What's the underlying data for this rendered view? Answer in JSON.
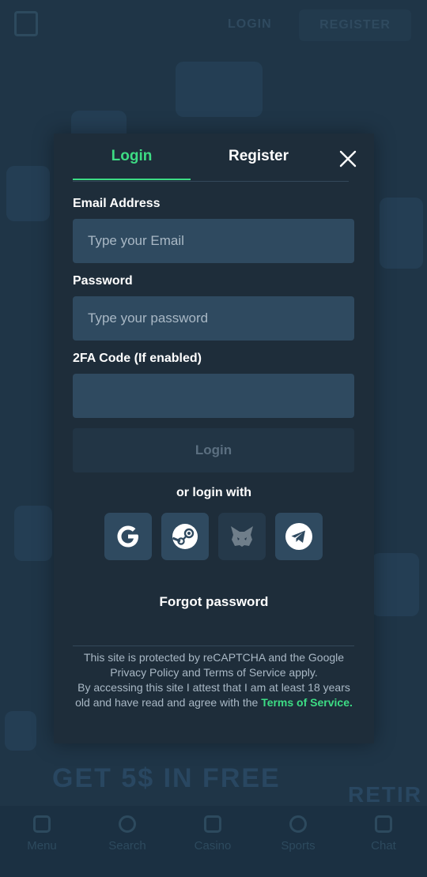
{
  "background": {
    "header_login": "LOGIN",
    "header_register": "REGISTER",
    "promo_text": "GET 5$ IN FREE",
    "side_text": "RETIR",
    "nav": [
      {
        "label": "Menu",
        "icon": "menu-icon"
      },
      {
        "label": "Search",
        "icon": "search-icon"
      },
      {
        "label": "Casino",
        "icon": "casino-icon"
      },
      {
        "label": "Sports",
        "icon": "sports-icon"
      },
      {
        "label": "Chat",
        "icon": "chat-icon"
      }
    ]
  },
  "modal": {
    "tabs": {
      "login": "Login",
      "register": "Register"
    },
    "email": {
      "label": "Email Address",
      "placeholder": "Type your Email",
      "value": ""
    },
    "password": {
      "label": "Password",
      "placeholder": "Type your password",
      "value": ""
    },
    "twofa": {
      "label": "2FA Code (If enabled)",
      "placeholder": "",
      "value": ""
    },
    "login_button": "Login",
    "or_login_with": "or login with",
    "social": [
      {
        "name": "google",
        "icon": "google-icon",
        "enabled": true
      },
      {
        "name": "steam",
        "icon": "steam-icon",
        "enabled": true
      },
      {
        "name": "metamask",
        "icon": "metamask-fox-icon",
        "enabled": false
      },
      {
        "name": "telegram",
        "icon": "telegram-icon",
        "enabled": true
      }
    ],
    "forgot_password": "Forgot password",
    "legal": {
      "line1": "This site is protected by reCAPTCHA and the Google Privacy Policy and Terms of Service apply.",
      "line2": "By accessing this site I attest that I am at least 18 years old and have read and agree with the",
      "terms_link": "Terms of Service."
    }
  },
  "colors": {
    "accent": "#3ddc84",
    "modal_bg": "#1e2d3a",
    "input_bg": "#2f4a60",
    "backdrop": "#1f3547"
  }
}
